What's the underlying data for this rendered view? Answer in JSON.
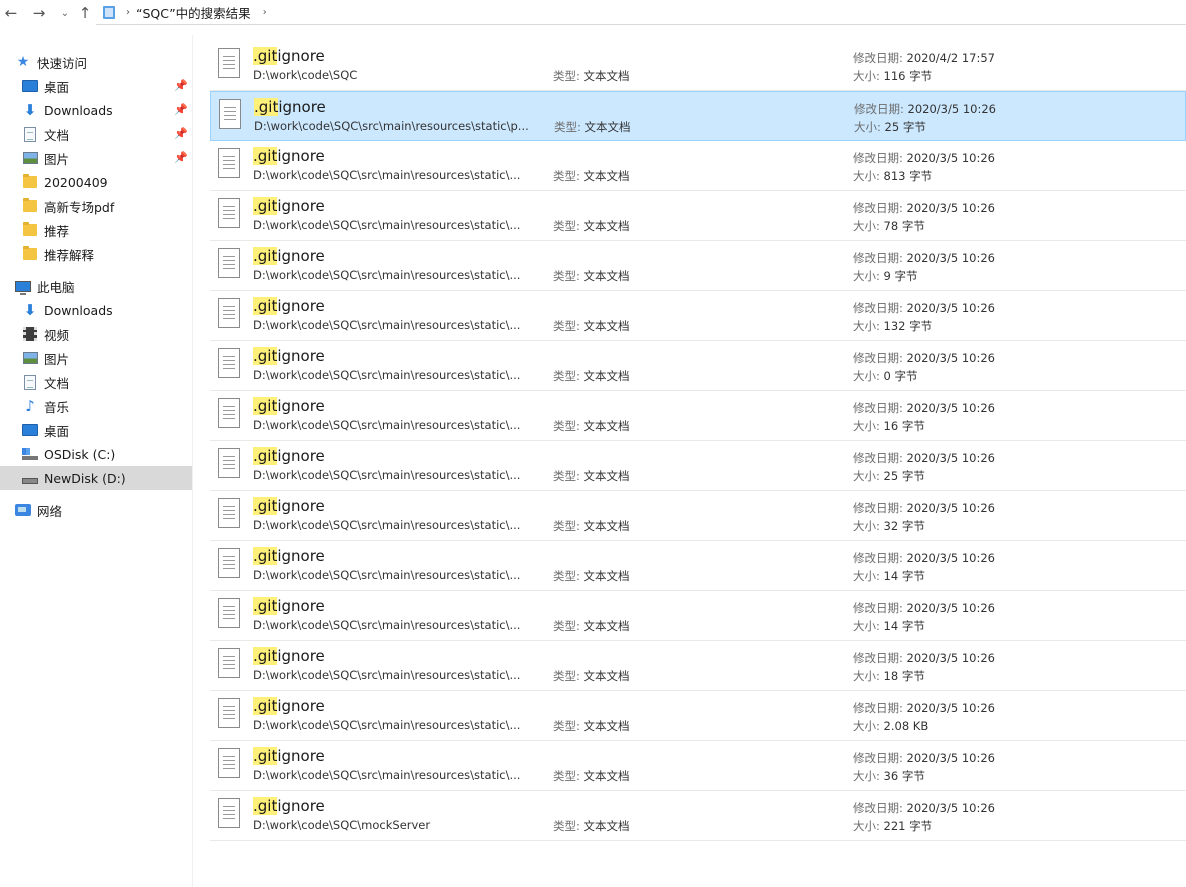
{
  "address": {
    "location": "“SQC”中的搜索结果"
  },
  "nav": [
    {
      "name": "nav-quick-access",
      "label": "快速访问",
      "icon": "star-icon",
      "level": 0,
      "pinned": false,
      "selected": false
    },
    {
      "name": "nav-desktop-pinned",
      "label": "桌面",
      "icon": "desktop-icon",
      "level": 1,
      "pinned": true,
      "selected": false
    },
    {
      "name": "nav-downloads-pinned",
      "label": "Downloads",
      "icon": "download-icon",
      "level": 1,
      "pinned": true,
      "selected": false
    },
    {
      "name": "nav-documents-pinned",
      "label": "文档",
      "icon": "document-icon",
      "level": 1,
      "pinned": true,
      "selected": false
    },
    {
      "name": "nav-pictures-pinned",
      "label": "图片",
      "icon": "picture-icon",
      "level": 1,
      "pinned": true,
      "selected": false
    },
    {
      "name": "nav-folder-20200409",
      "label": "20200409",
      "icon": "folder-icon",
      "level": 1,
      "pinned": false,
      "selected": false
    },
    {
      "name": "nav-folder-gaoxin",
      "label": "高新专场pdf",
      "icon": "folder-icon",
      "level": 1,
      "pinned": false,
      "selected": false
    },
    {
      "name": "nav-folder-tuijian",
      "label": "推荐",
      "icon": "folder-icon",
      "level": 1,
      "pinned": false,
      "selected": false
    },
    {
      "name": "nav-folder-tuijian-jieshi",
      "label": "推荐解释",
      "icon": "folder-icon",
      "level": 1,
      "pinned": false,
      "selected": false
    },
    {
      "name": "nav-this-pc",
      "label": "此电脑",
      "icon": "computer-icon",
      "level": 0,
      "pinned": false,
      "selected": false
    },
    {
      "name": "nav-downloads",
      "label": "Downloads",
      "icon": "download-icon",
      "level": 1,
      "pinned": false,
      "selected": false
    },
    {
      "name": "nav-videos",
      "label": "视频",
      "icon": "video-icon",
      "level": 1,
      "pinned": false,
      "selected": false
    },
    {
      "name": "nav-pictures",
      "label": "图片",
      "icon": "picture-icon",
      "level": 1,
      "pinned": false,
      "selected": false
    },
    {
      "name": "nav-documents",
      "label": "文档",
      "icon": "document-icon",
      "level": 1,
      "pinned": false,
      "selected": false
    },
    {
      "name": "nav-music",
      "label": "音乐",
      "icon": "music-icon",
      "level": 1,
      "pinned": false,
      "selected": false
    },
    {
      "name": "nav-desktop",
      "label": "桌面",
      "icon": "desktop-icon",
      "level": 1,
      "pinned": false,
      "selected": false
    },
    {
      "name": "nav-osdisk",
      "label": "OSDisk (C:)",
      "icon": "windows-disk-icon",
      "level": 1,
      "pinned": false,
      "selected": false
    },
    {
      "name": "nav-newdisk",
      "label": "NewDisk (D:)",
      "icon": "disk-icon",
      "level": 1,
      "pinned": false,
      "selected": true
    },
    {
      "name": "nav-network",
      "label": "网络",
      "icon": "network-icon",
      "level": 0,
      "pinned": false,
      "selected": false
    }
  ],
  "labels": {
    "type_key": "类型:",
    "date_key": "修改日期:",
    "size_key": "大小:"
  },
  "files": [
    {
      "name_hl": ".git",
      "name_rest": "ignore",
      "path": "D:\\work\\code\\SQC",
      "type": "文本文档",
      "date": "2020/4/2 17:57",
      "size": "116 字节",
      "selected": false
    },
    {
      "name_hl": ".git",
      "name_rest": "ignore",
      "path": "D:\\work\\code\\SQC\\src\\main\\resources\\static\\p...",
      "type": "文本文档",
      "date": "2020/3/5 10:26",
      "size": "25 字节",
      "selected": true
    },
    {
      "name_hl": ".git",
      "name_rest": "ignore",
      "path": "D:\\work\\code\\SQC\\src\\main\\resources\\static\\...",
      "type": "文本文档",
      "date": "2020/3/5 10:26",
      "size": "813 字节",
      "selected": false
    },
    {
      "name_hl": ".git",
      "name_rest": "ignore",
      "path": "D:\\work\\code\\SQC\\src\\main\\resources\\static\\...",
      "type": "文本文档",
      "date": "2020/3/5 10:26",
      "size": "78 字节",
      "selected": false
    },
    {
      "name_hl": ".git",
      "name_rest": "ignore",
      "path": "D:\\work\\code\\SQC\\src\\main\\resources\\static\\...",
      "type": "文本文档",
      "date": "2020/3/5 10:26",
      "size": "9 字节",
      "selected": false
    },
    {
      "name_hl": ".git",
      "name_rest": "ignore",
      "path": "D:\\work\\code\\SQC\\src\\main\\resources\\static\\...",
      "type": "文本文档",
      "date": "2020/3/5 10:26",
      "size": "132 字节",
      "selected": false
    },
    {
      "name_hl": ".git",
      "name_rest": "ignore",
      "path": "D:\\work\\code\\SQC\\src\\main\\resources\\static\\...",
      "type": "文本文档",
      "date": "2020/3/5 10:26",
      "size": "0 字节",
      "selected": false
    },
    {
      "name_hl": ".git",
      "name_rest": "ignore",
      "path": "D:\\work\\code\\SQC\\src\\main\\resources\\static\\...",
      "type": "文本文档",
      "date": "2020/3/5 10:26",
      "size": "16 字节",
      "selected": false
    },
    {
      "name_hl": ".git",
      "name_rest": "ignore",
      "path": "D:\\work\\code\\SQC\\src\\main\\resources\\static\\...",
      "type": "文本文档",
      "date": "2020/3/5 10:26",
      "size": "25 字节",
      "selected": false
    },
    {
      "name_hl": ".git",
      "name_rest": "ignore",
      "path": "D:\\work\\code\\SQC\\src\\main\\resources\\static\\...",
      "type": "文本文档",
      "date": "2020/3/5 10:26",
      "size": "32 字节",
      "selected": false
    },
    {
      "name_hl": ".git",
      "name_rest": "ignore",
      "path": "D:\\work\\code\\SQC\\src\\main\\resources\\static\\...",
      "type": "文本文档",
      "date": "2020/3/5 10:26",
      "size": "14 字节",
      "selected": false
    },
    {
      "name_hl": ".git",
      "name_rest": "ignore",
      "path": "D:\\work\\code\\SQC\\src\\main\\resources\\static\\...",
      "type": "文本文档",
      "date": "2020/3/5 10:26",
      "size": "14 字节",
      "selected": false
    },
    {
      "name_hl": ".git",
      "name_rest": "ignore",
      "path": "D:\\work\\code\\SQC\\src\\main\\resources\\static\\...",
      "type": "文本文档",
      "date": "2020/3/5 10:26",
      "size": "18 字节",
      "selected": false
    },
    {
      "name_hl": ".git",
      "name_rest": "ignore",
      "path": "D:\\work\\code\\SQC\\src\\main\\resources\\static\\...",
      "type": "文本文档",
      "date": "2020/3/5 10:26",
      "size": "2.08 KB",
      "selected": false
    },
    {
      "name_hl": ".git",
      "name_rest": "ignore",
      "path": "D:\\work\\code\\SQC\\src\\main\\resources\\static\\...",
      "type": "文本文档",
      "date": "2020/3/5 10:26",
      "size": "36 字节",
      "selected": false
    },
    {
      "name_hl": ".git",
      "name_rest": "ignore",
      "path": "D:\\work\\code\\SQC\\mockServer",
      "type": "文本文档",
      "date": "2020/3/5 10:26",
      "size": "221 字节",
      "selected": false
    }
  ]
}
